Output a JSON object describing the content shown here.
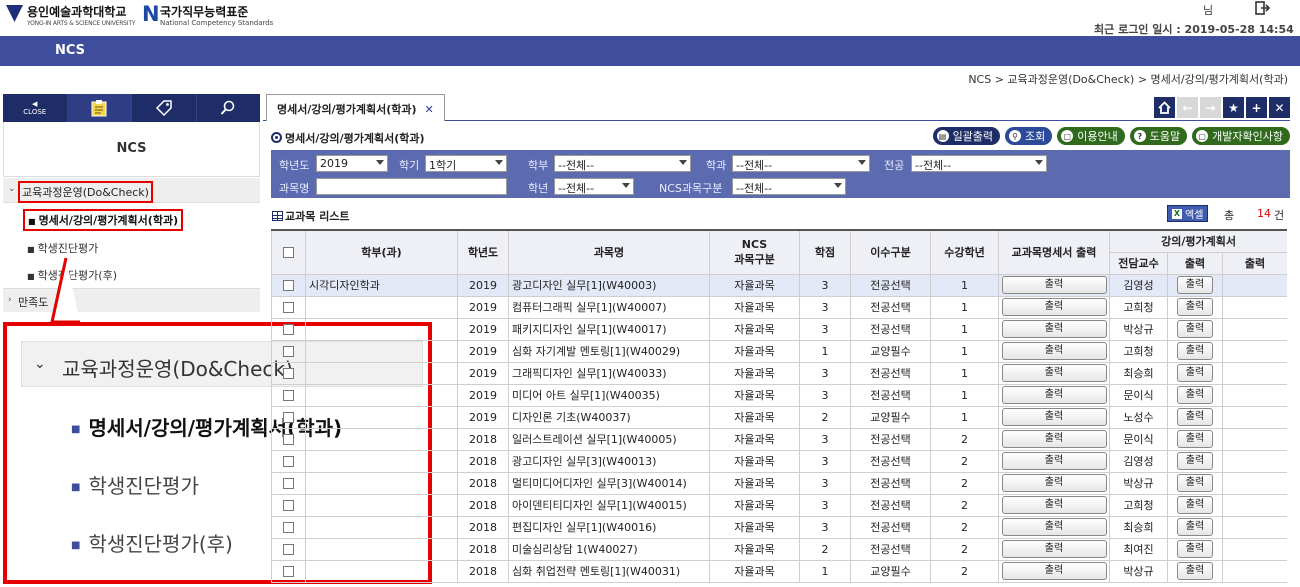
{
  "header": {
    "logo1_title": "용인예술과학대학교",
    "logo1_sub": "YONG-IN ARTS & SCIENCE UNIVERSITY",
    "logo2_title": "국가직무능력표준",
    "logo2_sub": "National Competency Standards",
    "user_suffix": "님",
    "last_login": "최근 로그인 일시 : 2019-05-28 14:54"
  },
  "navbar": {
    "title": "NCS"
  },
  "breadcrumb": "NCS > 교육과정운영(Do&Check) > 명세서/강의/평가계획서(학과)",
  "sidebar": {
    "close_label": "CLOSE",
    "title": "NCS",
    "category": "교육과정운영(Do&Check)",
    "items": [
      {
        "label": "명세서/강의/평가계획서(학과)"
      },
      {
        "label": "학생진단평가"
      },
      {
        "label": "학생진단평가(후)"
      }
    ],
    "category2": "만족도"
  },
  "zoom": {
    "category": "교육과정운영(Do&Check)",
    "items": [
      {
        "label": "명세서/강의/평가계획서(학과)"
      },
      {
        "label": "학생진단평가"
      },
      {
        "label": "학생진단평가(후)"
      }
    ]
  },
  "tab": {
    "label": "명세서/강의/평가계획서(학과)",
    "close": "✕"
  },
  "page": {
    "title": "명세서/강의/평가계획서(학과)"
  },
  "actions": {
    "print": "일괄출력",
    "search": "조회",
    "guide": "이용안내",
    "help": "도움말",
    "dev": "개발자확인사항"
  },
  "search": {
    "year_label": "학년도",
    "year_value": "2019",
    "term_label": "학기",
    "term_value": "1학기",
    "dept_label": "학부",
    "dept_value": "--전체--",
    "major_label": "학과",
    "major_value": "--전체--",
    "track_label": "전공",
    "track_value": "--전체--",
    "course_label": "과목명",
    "course_value": "",
    "grade_label": "학년",
    "grade_value": "--전체--",
    "ncs_label": "NCS과목구분",
    "ncs_value": "--전체--"
  },
  "list": {
    "title": "교과목 리스트",
    "excel": "엑셀",
    "total_label": "총",
    "total_count": "14",
    "total_unit": "건"
  },
  "table": {
    "headers": {
      "dept": "학부(과)",
      "year": "학년도",
      "course": "과목명",
      "ncs_line1": "NCS",
      "ncs_line2": "과목구분",
      "credit": "학점",
      "type": "이수구분",
      "grade": "수강학년",
      "spec_print": "교과목명세서 출력",
      "plan_group": "강의/평가계획서",
      "professor": "전담교수",
      "print1": "출력",
      "print2": "출력"
    },
    "button_label": "출력",
    "rows": [
      {
        "dept": "시각디자인학과",
        "year": "2019",
        "course": "광고디자인 실무[1](W40003)",
        "ncs": "자율과목",
        "credit": "3",
        "type": "전공선택",
        "grade": "1",
        "prof": "김영성"
      },
      {
        "dept": "",
        "year": "2019",
        "course": "컴퓨터그래픽 실무[1](W40007)",
        "ncs": "자율과목",
        "credit": "3",
        "type": "전공선택",
        "grade": "1",
        "prof": "고희청"
      },
      {
        "dept": "",
        "year": "2019",
        "course": "패키지디자인 실무[1](W40017)",
        "ncs": "자율과목",
        "credit": "3",
        "type": "전공선택",
        "grade": "1",
        "prof": "박상규"
      },
      {
        "dept": "",
        "year": "2019",
        "course": "심화 자기계발 멘토링[1](W40029)",
        "ncs": "자율과목",
        "credit": "1",
        "type": "교양필수",
        "grade": "1",
        "prof": "고희청"
      },
      {
        "dept": "",
        "year": "2019",
        "course": "그래픽디자인 실무[1](W40033)",
        "ncs": "자율과목",
        "credit": "3",
        "type": "전공선택",
        "grade": "1",
        "prof": "최승희"
      },
      {
        "dept": "",
        "year": "2019",
        "course": "미디어 아트 실무[1](W40035)",
        "ncs": "자율과목",
        "credit": "3",
        "type": "전공선택",
        "grade": "1",
        "prof": "문이식"
      },
      {
        "dept": "",
        "year": "2019",
        "course": "디자인론 기초(W40037)",
        "ncs": "자율과목",
        "credit": "2",
        "type": "교양필수",
        "grade": "1",
        "prof": "노성수"
      },
      {
        "dept": "",
        "year": "2018",
        "course": "일러스트레이션 실무[1](W40005)",
        "ncs": "자율과목",
        "credit": "3",
        "type": "전공선택",
        "grade": "2",
        "prof": "문이식"
      },
      {
        "dept": "",
        "year": "2018",
        "course": "광고디자인 실무[3](W40013)",
        "ncs": "자율과목",
        "credit": "3",
        "type": "전공선택",
        "grade": "2",
        "prof": "김영성"
      },
      {
        "dept": "",
        "year": "2018",
        "course": "멀티미디어디자인 실무[3](W40014)",
        "ncs": "자율과목",
        "credit": "3",
        "type": "전공선택",
        "grade": "2",
        "prof": "박상규"
      },
      {
        "dept": "",
        "year": "2018",
        "course": "아이덴티티디자인 실무[1](W40015)",
        "ncs": "자율과목",
        "credit": "3",
        "type": "전공선택",
        "grade": "2",
        "prof": "고희청"
      },
      {
        "dept": "",
        "year": "2018",
        "course": "편집디자인 실무[1](W40016)",
        "ncs": "자율과목",
        "credit": "3",
        "type": "전공선택",
        "grade": "2",
        "prof": "최승희"
      },
      {
        "dept": "",
        "year": "2018",
        "course": "미술심리상담 1(W40027)",
        "ncs": "자율과목",
        "credit": "2",
        "type": "전공선택",
        "grade": "2",
        "prof": "최여진"
      },
      {
        "dept": "",
        "year": "2018",
        "course": "심화 취업전략 멘토링[1](W40031)",
        "ncs": "자율과목",
        "credit": "1",
        "type": "교양필수",
        "grade": "2",
        "prof": "박상규"
      }
    ]
  },
  "colors": {
    "navy": "#1e2c67",
    "nav_blue": "#3f4e9c",
    "panel_blue": "#5c6bb0",
    "highlight_red": "#e60000"
  }
}
